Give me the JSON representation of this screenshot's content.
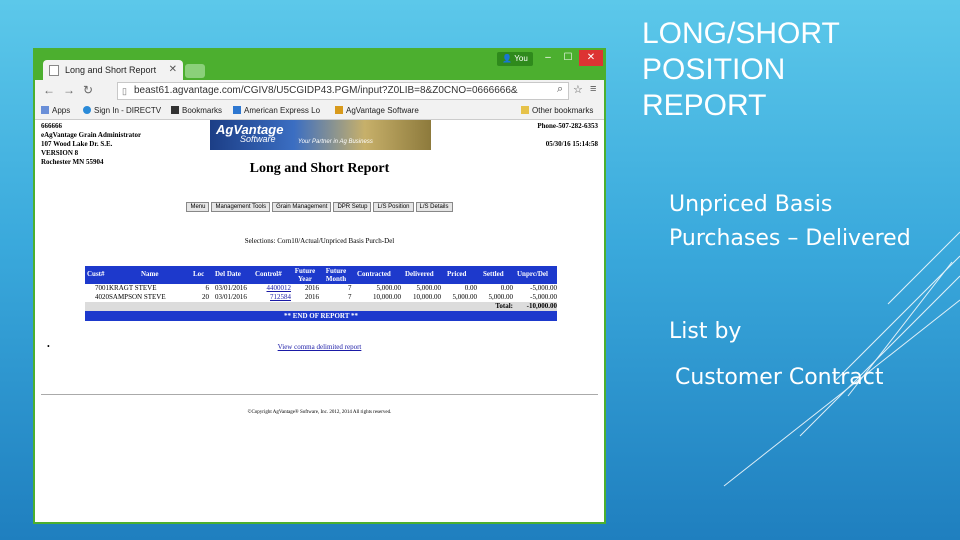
{
  "slide": {
    "title_lines": [
      "LONG/SHORT",
      "POSITION",
      "REPORT"
    ],
    "bullets": [
      "Unpriced Basis",
      "Purchases – Delivered",
      "List by",
      "Customer Contract"
    ]
  },
  "browser": {
    "tab_title": "Long and Short Report",
    "user_badge": "You",
    "url": "beast61.agvantage.com/CGIV8/U5CGIDP43.PGM/input?Z0LIB=8&Z0CNO=0666666&",
    "bookmarks": [
      "Apps",
      "Sign In - DIRECTV",
      "Bookmarks",
      "American Express Lo",
      "AgVantage Software",
      "Other bookmarks"
    ]
  },
  "report": {
    "company": [
      "666666",
      "eAgVantage Grain Administrator",
      "107 Wood Lake Dr. S.E.",
      "VERSION 8",
      "Rochester MN 55904"
    ],
    "phone": "Phone-507-282-6353",
    "datetime": "05/30/16 15:14:58",
    "logo_main": "AgVantage",
    "logo_sub": "Software",
    "logo_tagline": "Your Partner in Ag Business",
    "title": "Long and Short Report",
    "menu": [
      "Menu",
      "Management Tools",
      "Grain Management",
      "DPR Setup",
      "L/S Position",
      "L/S Details"
    ],
    "selections": "Selections: Corn10/Actual/Unpriced Basis Purch-Del",
    "columns": [
      "Cust#",
      "Name",
      "Loc",
      "Del Date",
      "Control#",
      "Future Year",
      "Future Month",
      "Contracted",
      "Delivered",
      "Priced",
      "Settled",
      "Unprc/Del"
    ],
    "rows": [
      {
        "cust_name": "7001KRAGT STEVE",
        "loc": "6",
        "del_date": "03/01/2016",
        "control": "4400012",
        "fut_year": "2016",
        "fut_month": "7",
        "contracted": "5,000.00",
        "delivered": "5,000.00",
        "priced": "0.00",
        "settled": "0.00",
        "unprc": "-5,000.00"
      },
      {
        "cust_name": "4020SAMPSON STEVE",
        "loc": "20",
        "del_date": "03/01/2016",
        "control": "712584",
        "fut_year": "2016",
        "fut_month": "7",
        "contracted": "10,000.00",
        "delivered": "10,000.00",
        "priced": "5,000.00",
        "settled": "5,000.00",
        "unprc": "-5,000.00"
      }
    ],
    "total_label": "Total:",
    "total_value": "-10,000.00",
    "end_label": "** END OF REPORT **",
    "csv_link": "View comma delimited report",
    "copyright": "©Copyright AgVantage® Software, Inc. 2012, 2014 All rights reserved."
  },
  "colors": {
    "background": "#3aa9dc",
    "browser_frame": "#4caf2f",
    "table_header": "#1d39cc"
  }
}
